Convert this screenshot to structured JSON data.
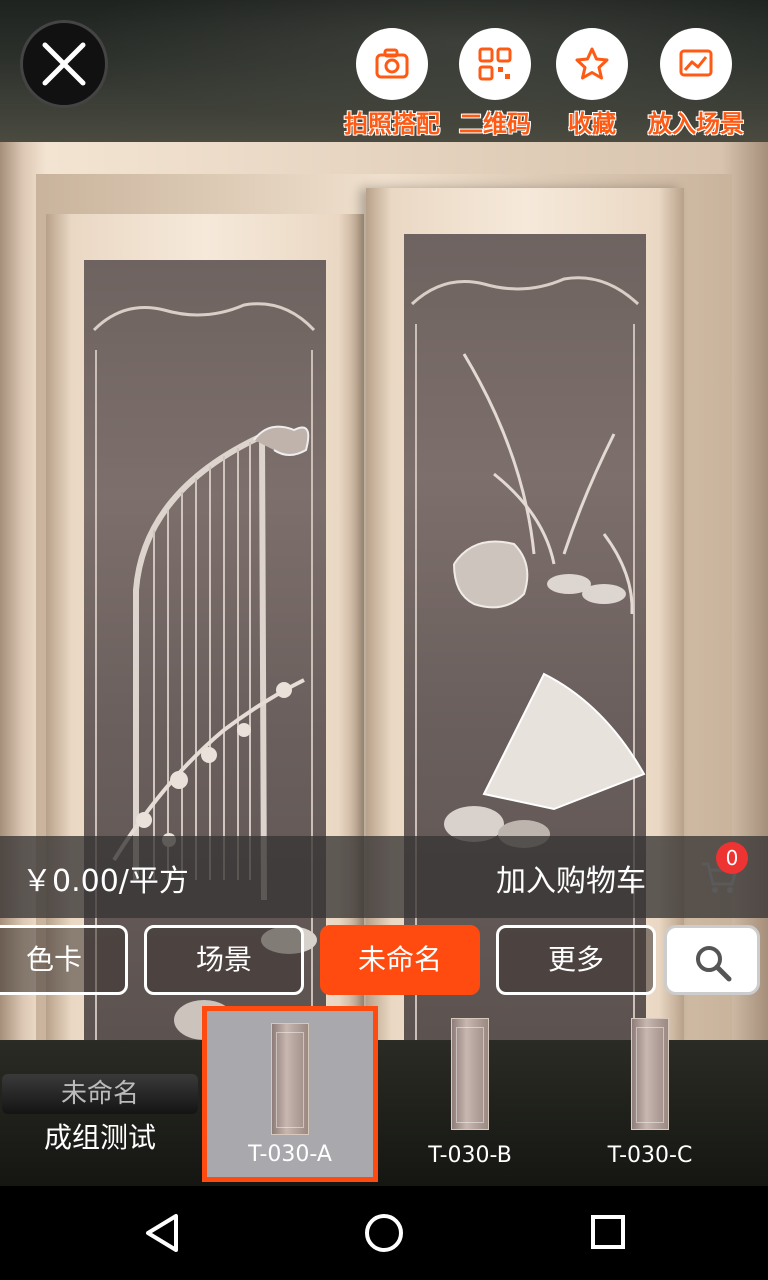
{
  "top_actions": [
    {
      "label": "拍照搭配",
      "icon": "camera-icon"
    },
    {
      "label": "二维码",
      "icon": "qr-code-icon"
    },
    {
      "label": "收藏",
      "icon": "star-icon"
    },
    {
      "label": "放入场景",
      "icon": "scene-image-icon"
    }
  ],
  "close_icon": "close-icon",
  "price_bar": {
    "price": "￥0.00/平方",
    "add_to_cart": "加入购物车",
    "cart_count": "0"
  },
  "tabs": [
    {
      "label": "色卡",
      "active": false
    },
    {
      "label": "场景",
      "active": false
    },
    {
      "label": "未命名",
      "active": true
    },
    {
      "label": "更多",
      "active": false
    }
  ],
  "group": {
    "name": "未命名",
    "title": "成组测试"
  },
  "thumbnails": [
    {
      "label": "T-030-A",
      "selected": true
    },
    {
      "label": "T-030-B",
      "selected": false
    },
    {
      "label": "T-030-C",
      "selected": false
    }
  ],
  "colors": {
    "accent": "#ff4a10",
    "badge": "#ee3333"
  }
}
